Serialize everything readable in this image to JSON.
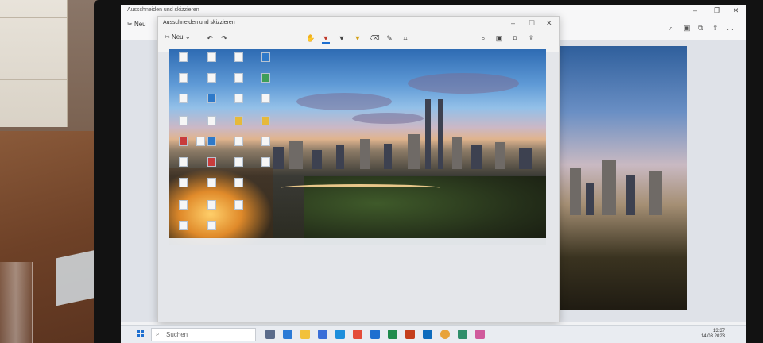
{
  "back_window": {
    "title": "Ausschneiden und skizzieren",
    "new_label": "Neu"
  },
  "front_window": {
    "title": "Ausschneiden und skizzieren",
    "new_label": "Neu"
  },
  "taskbar": {
    "search_placeholder": "Suchen",
    "clock_time": "13:37",
    "clock_date": "14.03.2023"
  },
  "icons": {
    "window_controls": [
      "minimize-icon",
      "maximize-icon",
      "close-icon"
    ],
    "tools": [
      "touch-writing-icon",
      "ballpoint-pen-icon",
      "pencil-icon",
      "highlighter-icon",
      "eraser-icon",
      "ruler-icon",
      "crop-icon"
    ],
    "actions": [
      "zoom-icon",
      "save-icon",
      "copy-icon",
      "share-icon",
      "more-icon"
    ]
  },
  "colors": {
    "accent": "#1e6fd0",
    "taskbar": "#e9ecf1",
    "window_bg": "#f3f3f3"
  }
}
